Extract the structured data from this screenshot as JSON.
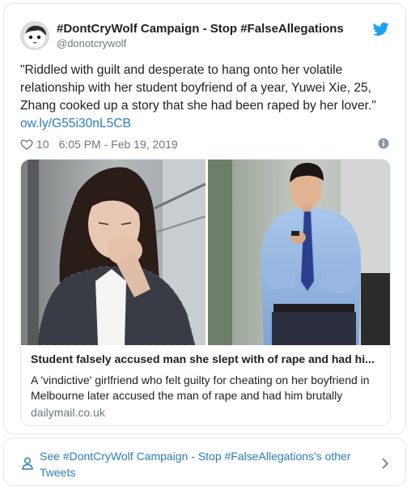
{
  "tweet": {
    "author_name": "#DontCryWolf Campaign - Stop #FalseAllegations",
    "author_handle": "@donotcrywolf",
    "text": "\"Riddled with guilt and desperate to hang onto her volatile relationship with her student boyfriend of a year, Yuwei Xie, 25, Zhang cooked up a story that she had been raped by her lover.\"",
    "link_text": "ow.ly/G55i30nL5CB",
    "like_count": "10",
    "timestamp": "6:05 PM - Feb 19, 2019"
  },
  "card": {
    "title": "Student falsely accused man she slept with of rape and had hi...",
    "description": "A 'vindictive' girlfriend who felt guilty for cheating on her boyfriend in Melbourne later accused the man of rape and had him brutally",
    "domain": "dailymail.co.uk"
  },
  "footer": {
    "label": "See #DontCryWolf Campaign - Stop #FalseAllegations's other Tweets"
  },
  "icons": {
    "brand": "twitter-bird-icon",
    "like": "heart-icon",
    "info": "info-icon",
    "person": "person-icon",
    "next": "chevron-right-icon"
  },
  "colors": {
    "twitter_blue": "#1da1f2",
    "link": "#2b7bb9",
    "muted": "#697882",
    "text": "#1c2022",
    "border": "#e1e8ed"
  }
}
